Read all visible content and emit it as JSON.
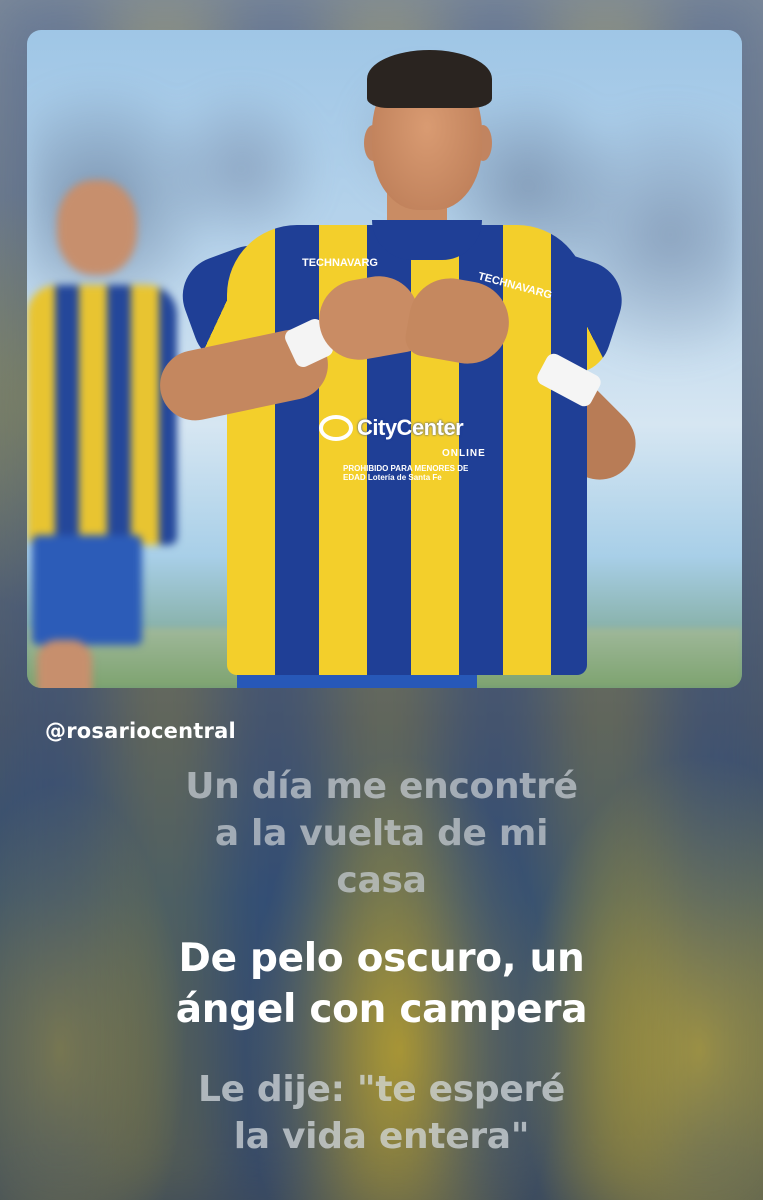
{
  "story": {
    "username": "@rosariocentral",
    "photo": {
      "jersey_sponsor": "CityCenter",
      "jersey_sponsor_sub": "ONLINE",
      "jersey_brand": "TECHNAVARG",
      "jersey_note": "PROHIBIDO PARA MENORES DE EDAD",
      "jersey_lottery": "Lotería de Santa Fe"
    },
    "lyrics": {
      "previous": [
        "Un día me encontré",
        "a la vuelta de mi",
        "casa"
      ],
      "current": [
        "De pelo oscuro, un",
        "ángel con campera"
      ],
      "next": [
        "Le dije: \"te esperé",
        "la vida entera\""
      ]
    }
  }
}
